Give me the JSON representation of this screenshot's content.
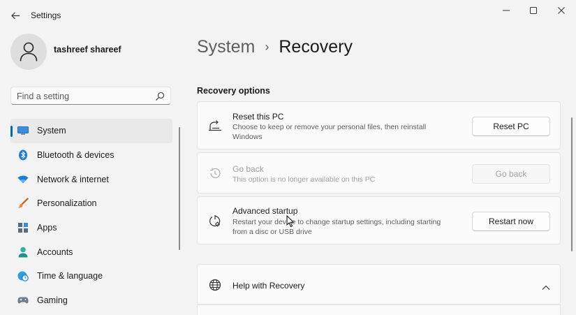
{
  "window": {
    "app_title": "Settings",
    "back_icon": "arrow-left-icon",
    "controls": [
      "minimize-icon",
      "maximize-icon",
      "close-icon"
    ]
  },
  "user": {
    "name": "tashreef shareef",
    "avatar_icon": "person-icon"
  },
  "search": {
    "placeholder": "Find a setting",
    "value": ""
  },
  "sidebar": {
    "items": [
      {
        "label": "System",
        "icon": "monitor-icon",
        "active": true
      },
      {
        "label": "Bluetooth & devices",
        "icon": "bluetooth-icon",
        "active": false
      },
      {
        "label": "Network & internet",
        "icon": "wifi-icon",
        "active": false
      },
      {
        "label": "Personalization",
        "icon": "brush-icon",
        "active": false
      },
      {
        "label": "Apps",
        "icon": "apps-icon",
        "active": false
      },
      {
        "label": "Accounts",
        "icon": "account-icon",
        "active": false
      },
      {
        "label": "Time & language",
        "icon": "globe-clock-icon",
        "active": false
      },
      {
        "label": "Gaming",
        "icon": "gamepad-icon",
        "active": false
      }
    ]
  },
  "breadcrumb": {
    "parent": "System",
    "separator": "›",
    "current": "Recovery"
  },
  "recovery": {
    "section_title": "Recovery options",
    "cards": [
      {
        "title": "Reset this PC",
        "description": "Choose to keep or remove your personal files, then reinstall Windows",
        "button": "Reset PC",
        "icon": "reset-pc-icon",
        "enabled": true
      },
      {
        "title": "Go back",
        "description": "This option is no longer available on this PC",
        "button": "Go back",
        "icon": "history-icon",
        "enabled": false
      },
      {
        "title": "Advanced startup",
        "description": "Restart your device to change startup settings, including starting from a disc or USB drive",
        "button": "Restart now",
        "icon": "advanced-startup-icon",
        "enabled": true
      }
    ],
    "help": {
      "title": "Help with Recovery",
      "icon": "globe-icon",
      "expand_icon": "chevron-up-icon"
    }
  },
  "colors": {
    "accent": "#0067c0",
    "background": "#f3f3f3",
    "card": "#fbfbfb"
  }
}
